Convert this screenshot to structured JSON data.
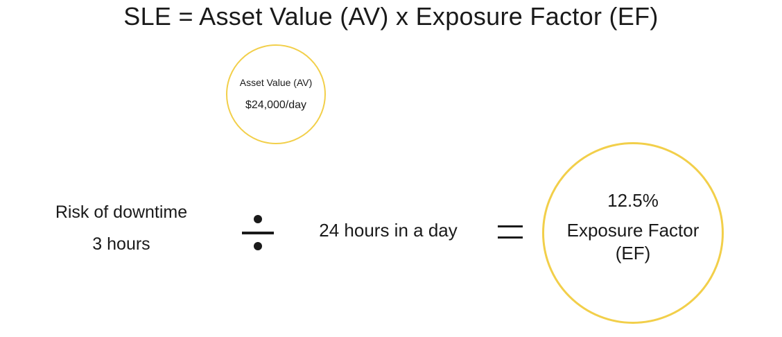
{
  "title": "SLE = Asset Value (AV) x Exposure Factor (EF)",
  "asset_value": {
    "label": "Asset Value (AV)",
    "value": "$24,000/day"
  },
  "risk": {
    "label": "Risk of downtime",
    "value": "3 hours"
  },
  "operator_divide": "divide-icon",
  "hours_in_day": "24 hours in a day",
  "operator_equals": "equals-icon",
  "exposure_factor": {
    "percent": "12.5%",
    "label": "Exposure Factor (EF)"
  },
  "colors": {
    "circle_border": "#f2cf4a",
    "text": "#1a1a1a"
  }
}
